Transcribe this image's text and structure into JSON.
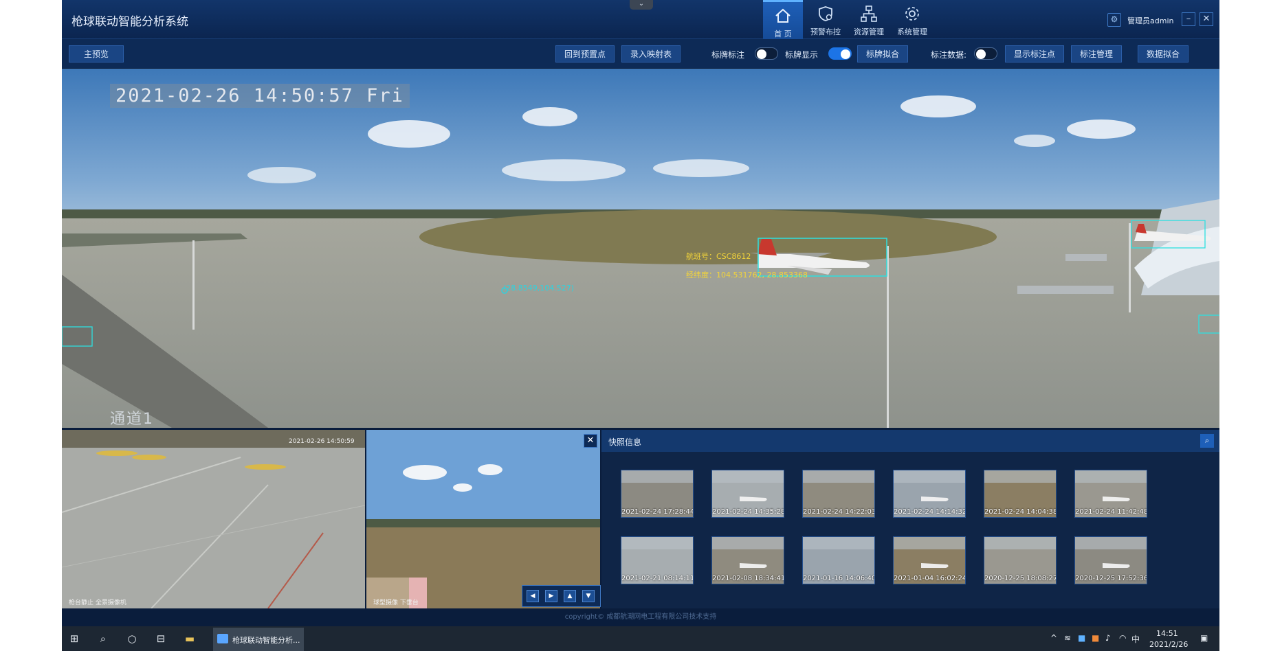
{
  "header": {
    "title": "枪球联动智能分析系统",
    "nav": [
      {
        "label": "首 页",
        "icon": "home-icon"
      },
      {
        "label": "预警布控",
        "icon": "shield-gear-icon"
      },
      {
        "label": "资源管理",
        "icon": "sitemap-icon"
      },
      {
        "label": "系统管理",
        "icon": "gear-icon"
      }
    ],
    "user": "管理员admin",
    "minimize": "–",
    "close": "✕"
  },
  "toolbar": {
    "main_preview": "主预览",
    "back_to_preset": "回到预置点",
    "enter_mapping": "录入映射表",
    "label_annotate": "标牌标注",
    "label_display": "标牌显示",
    "label_fit": "标牌拟合",
    "annotation_data": "标注数据:",
    "show_points": "显示标注点",
    "annotation_mgmt": "标注管理",
    "data_fit": "数据拟合",
    "toggles": {
      "annotate": false,
      "display": true,
      "annotation_data": false
    }
  },
  "main_video": {
    "timestamp": "2021-02-26 14:50:57 Fri",
    "channel": "通道1",
    "flight_no": "航班号：CSC8612",
    "lonlat": "经纬度：104.531762, 28.853368",
    "coord_marker": "(28.8549,104.527)"
  },
  "sub_video_left": {
    "timestamp": "2021-02-26 14:50:59",
    "caption": "枪台静止 全景摄像机"
  },
  "sub_video_right": {
    "caption": "球型摄像 下垂台",
    "close": "✕"
  },
  "ptz": [
    "◀",
    "▶",
    "▲",
    "▼"
  ],
  "snapshots": {
    "title": "快照信息",
    "items": [
      "2021-02-24 17:28:44",
      "2021-02-24 14:35:28",
      "2021-02-24 14:22:03",
      "2021-02-24 14:14:32",
      "2021-02-24 14:04:38",
      "2021-02-24 11:42:48",
      "2021-02-21 08:14:11",
      "2021-02-08 18:34:41",
      "2021-01-16 14:06:40",
      "2021-01-04 16:02:24",
      "2020-12-25 18:08:27",
      "2020-12-25 17:52:36"
    ]
  },
  "footer": "copyright© 成都航潮网电工程有限公司技术支持",
  "taskbar": {
    "app_label": "枪球联动智能分析...",
    "time": "14:51",
    "date": "2021/2/26",
    "ime": "中"
  }
}
